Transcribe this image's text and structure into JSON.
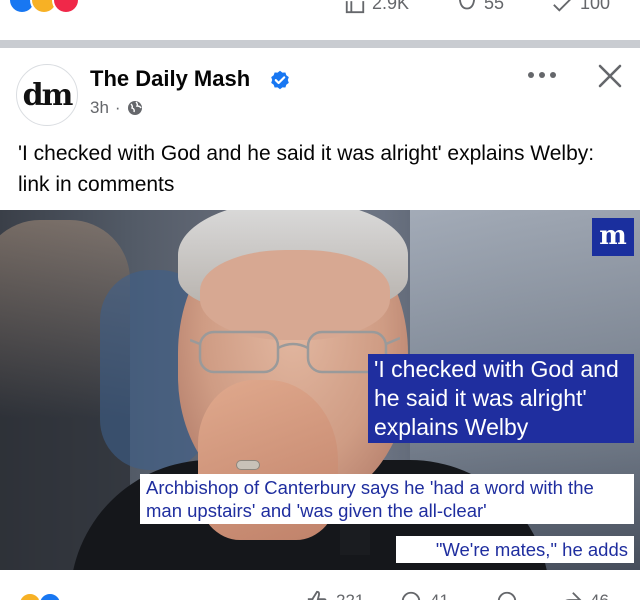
{
  "previous_post": {
    "shares": "2.9K",
    "comments": "55",
    "extra": "100"
  },
  "post": {
    "page_name": "The Daily Mash",
    "avatar_text": "dm",
    "time": "3h",
    "separator": "·",
    "caption": "'I checked with God and he said it was alright' explains Welby: link in comments",
    "image": {
      "badge": "m",
      "headline": "'I checked with God and he said it was alright' explains Welby",
      "subheadline": "Archbishop of Canterbury says he 'had a word with the man upstairs' and 'was given the all-clear'",
      "tagline": "\"We're mates,\" he adds"
    }
  },
  "next_post": {
    "likes": "221",
    "comments": "41",
    "shares": "46"
  },
  "colors": {
    "facebook_blue": "#1877f2",
    "mash_blue": "#1f2e9f",
    "meta_gray": "#65676b",
    "divider": "#c9ccd1"
  },
  "icons": [
    "verified-badge-icon",
    "globe-icon",
    "more-options-icon",
    "close-icon",
    "like-icon",
    "comment-icon",
    "share-icon"
  ]
}
